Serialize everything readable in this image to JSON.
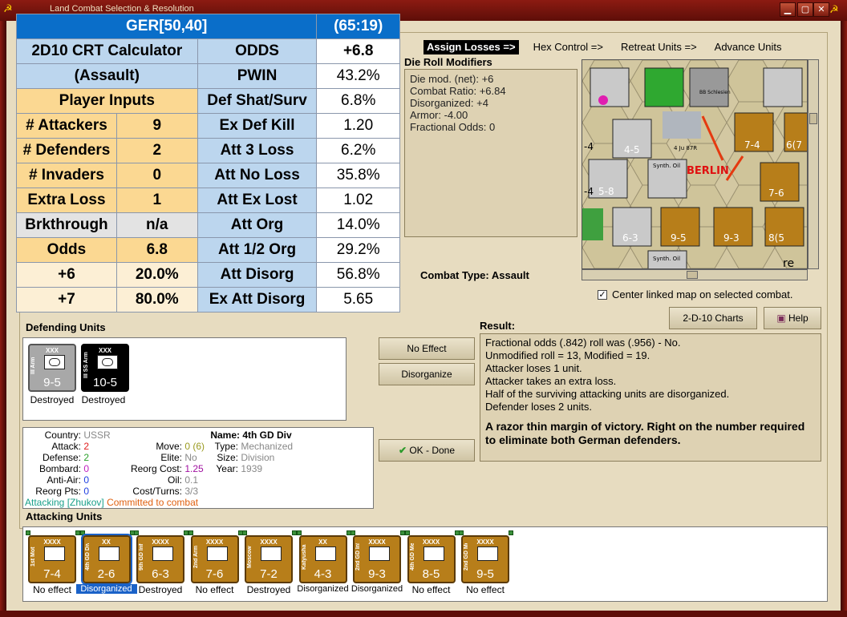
{
  "window": {
    "title": "Land Combat Selection & Resolution",
    "minimize": "▁",
    "maximize": "▢",
    "close": "✕"
  },
  "phases": [
    "Assign Losses =>",
    "Hex Control =>",
    "Retreat Units =>",
    "Advance Units"
  ],
  "active_phase": "Assign Losses =>",
  "crt": {
    "header": {
      "left": "GER[50,40]",
      "right": "(65:19)"
    },
    "title1": "2D10 CRT Calculator",
    "title2": "(Assault)",
    "player_inputs": "Player Inputs",
    "inputs": [
      {
        "label": "# Attackers",
        "value": "9"
      },
      {
        "label": "# Defenders",
        "value": "2"
      },
      {
        "label": "# Invaders",
        "value": "0"
      },
      {
        "label": "Extra Loss",
        "value": "1"
      },
      {
        "label": "Brkthrough",
        "value": "n/a"
      },
      {
        "label": "Odds",
        "value": "6.8"
      },
      {
        "label": "+6",
        "value": "20.0%"
      },
      {
        "label": "+7",
        "value": "80.0%"
      }
    ],
    "results": [
      {
        "label": "ODDS",
        "value": "+6.8"
      },
      {
        "label": "PWIN",
        "value": "43.2%"
      },
      {
        "label": "Def Shat/Surv",
        "value": "6.8%"
      },
      {
        "label": "Ex Def Kill",
        "value": "1.20"
      },
      {
        "label": "Att 3 Loss",
        "value": "6.2%"
      },
      {
        "label": "Att No Loss",
        "value": "35.8%"
      },
      {
        "label": "Att Ex Lost",
        "value": "1.02"
      },
      {
        "label": "Att Org",
        "value": "14.0%"
      },
      {
        "label": "Att 1/2 Org",
        "value": "29.2%"
      },
      {
        "label": "Att Disorg",
        "value": "56.8%"
      },
      {
        "label": "Ex Att Disorg",
        "value": "5.65"
      }
    ]
  },
  "drm": {
    "label": "Die Roll Modifiers",
    "lines": [
      "Die mod. (net): +6",
      "",
      "Combat Ratio: +6.84",
      "Disorganized: +4",
      "Armor: -4.00",
      "Fractional Odds: 0"
    ]
  },
  "map": {
    "city": "BERLIN",
    "hex_labels": [
      "7-4",
      "5-8",
      "6-3",
      "9-5",
      "9-3",
      "7-6",
      "8(5",
      "6(7",
      "4-5",
      "4 Ju 87R",
      "BB Schlesien",
      "Synth. Oil",
      "Synth. Oil",
      "re",
      "-4",
      "-4"
    ]
  },
  "center_linked": {
    "label": "Center linked map on selected combat.",
    "checked": "✓"
  },
  "combat_type": {
    "label": "Combat Type:",
    "value": "Assault"
  },
  "buttons": {
    "charts": "2-D-10 Charts",
    "help": "Help",
    "no_effect": "No Effect",
    "disorganize": "Disorganize",
    "ok": "OK - Done"
  },
  "defending": {
    "label": "Defending Units",
    "units": [
      {
        "name": "III Arm",
        "size": "XXX",
        "value": "9-5",
        "status": "Destroyed",
        "color": "#a8a8a8"
      },
      {
        "name": "III SS Arm",
        "size": "XXX",
        "value": "10-5",
        "status": "Destroyed",
        "color": "#000000"
      }
    ]
  },
  "result": {
    "label": "Result:",
    "lines": [
      "Fractional odds (.842) roll was (.956)  - No.",
      "Unmodified roll = 13, Modified = 19.",
      "Attacker loses 1 unit.",
      "Attacker takes an extra loss.",
      "Half of the surviving attacking units are disorganized.",
      "Defender loses 2 units."
    ],
    "comment": "A razor thin margin of victory.  Right on the number required to eliminate both German defenders."
  },
  "unit_info": {
    "country_k": "Country:",
    "country_v": "USSR",
    "attack_k": "Attack:",
    "attack_v": "2",
    "defense_k": "Defense:",
    "defense_v": "2",
    "bombard_k": "Bombard:",
    "bombard_v": "0",
    "antiair_k": "Anti-Air:",
    "antiair_v": "0",
    "reorgpts_k": "Reorg Pts:",
    "reorgpts_v": "0",
    "name_k": "Name:",
    "name_v": "4th GD Div",
    "move_k": "Move:",
    "move_v": "0 (6)",
    "type_k": "Type:",
    "type_v": "Mechanized",
    "elite_k": "Elite:",
    "elite_v": "No",
    "size_k": "Size:",
    "size_v": "Division",
    "reorg_k": "Reorg Cost:",
    "reorg_v": "1.25",
    "year_k": "Year:",
    "year_v": "1939",
    "oil_k": "Oil:",
    "oil_v": "0.1",
    "cost_k": "Cost/Turns:",
    "cost_v": "3/3",
    "attacking": "Attacking [Zhukov]",
    "committed": "Committed to combat"
  },
  "attacking": {
    "label": "Attacking Units",
    "units": [
      {
        "name": "1st Mot",
        "size": "XXXX",
        "value": "7-4",
        "status": "No effect",
        "selected": ""
      },
      {
        "name": "4th GD Div",
        "size": "XX",
        "value": "2-6",
        "status": "Disorganized",
        "selected": "yes"
      },
      {
        "name": "9th GD Inf",
        "size": "XXXX",
        "value": "6-3",
        "status": "Destroyed",
        "selected": ""
      },
      {
        "name": "2nd Arm",
        "size": "XXXX",
        "value": "7-6",
        "status": "No effect",
        "selected": ""
      },
      {
        "name": "Moscow",
        "size": "XXXX",
        "value": "7-2",
        "status": "Destroyed",
        "selected": ""
      },
      {
        "name": "Katyusha",
        "size": "XX",
        "value": "4-3",
        "status": "Disorganized",
        "selected": ""
      },
      {
        "name": "2nd GD Inf",
        "size": "XXXX",
        "value": "9-3",
        "status": "Disorganized",
        "selected": ""
      },
      {
        "name": "4th GD Mech",
        "size": "XXXX",
        "value": "8-5",
        "status": "No effect",
        "selected": ""
      },
      {
        "name": "2nd GD Mech",
        "size": "XXXX",
        "value": "9-5",
        "status": "No effect",
        "selected": ""
      }
    ]
  },
  "colors": {
    "soviet_counter": "#b77e1a",
    "crt_header": "#0a6ec9",
    "selected": "#1a62c8"
  }
}
